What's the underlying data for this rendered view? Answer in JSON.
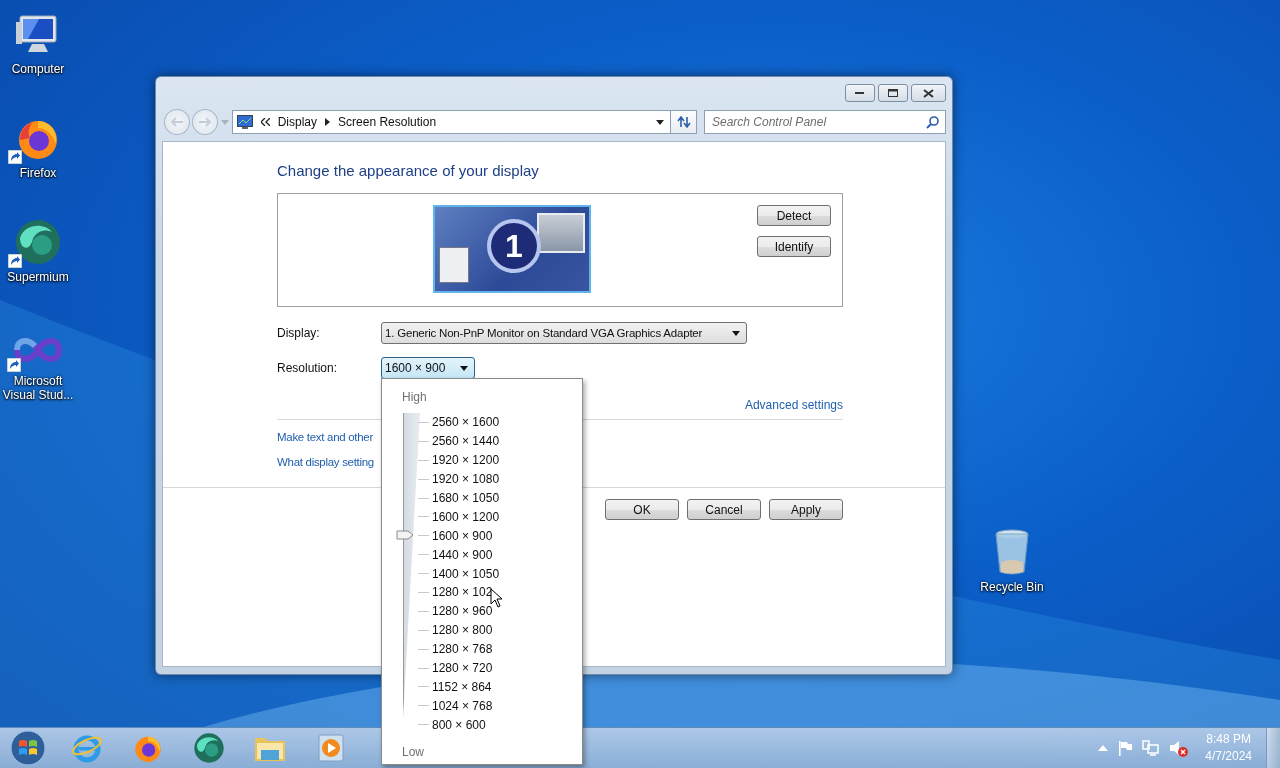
{
  "desktop_icons": [
    {
      "label": "Computer",
      "kind": "computer",
      "shortcut": false
    },
    {
      "label": "Firefox",
      "kind": "firefox",
      "shortcut": true
    },
    {
      "label": "Supermium",
      "kind": "supermium",
      "shortcut": true
    },
    {
      "label": "Microsoft Visual Stud...",
      "kind": "visualstudio",
      "shortcut": true
    },
    {
      "label": "Recycle Bin",
      "kind": "recyclebin",
      "shortcut": false
    }
  ],
  "window": {
    "breadcrumb": [
      "Display",
      "Screen Resolution"
    ],
    "search": {
      "placeholder": "Search Control Panel"
    },
    "heading": "Change the appearance of your display",
    "monitor_number": "1",
    "side_buttons": [
      "Detect",
      "Identify"
    ],
    "display": {
      "label": "Display:",
      "value": "1. Generic Non-PnP Monitor on Standard VGA Graphics Adapter"
    },
    "resolution": {
      "label": "Resolution:",
      "value": "1600 × 900",
      "expanded": true
    },
    "advanced_link": "Advanced settings",
    "links": [
      "Make text and other",
      "What display setting"
    ],
    "buttons": [
      "OK",
      "Cancel",
      "Apply"
    ]
  },
  "resolution_list": {
    "high_label": "High",
    "low_label": "Low",
    "items": [
      {
        "label": "2560 × 1600",
        "selected": false
      },
      {
        "label": "2560 × 1440",
        "selected": false
      },
      {
        "label": "1920 × 1200",
        "selected": false
      },
      {
        "label": "1920 × 1080",
        "selected": false
      },
      {
        "label": "1680 × 1050",
        "selected": false
      },
      {
        "label": "1600 × 1200",
        "selected": false
      },
      {
        "label": "1600 × 900",
        "selected": true
      },
      {
        "label": "1440 × 900",
        "selected": false
      },
      {
        "label": "1400 × 1050",
        "selected": false
      },
      {
        "label": "1280 × 102",
        "selected": false,
        "pointer": true
      },
      {
        "label": "1280 × 960",
        "selected": false
      },
      {
        "label": "1280 × 800",
        "selected": false
      },
      {
        "label": "1280 × 768",
        "selected": false
      },
      {
        "label": "1280 × 720",
        "selected": false
      },
      {
        "label": "1152 × 864",
        "selected": false
      },
      {
        "label": "1024 × 768",
        "selected": false
      },
      {
        "label": "800 × 600",
        "selected": false
      }
    ]
  },
  "taskbar": {
    "pinned": [
      {
        "kind": "ie"
      },
      {
        "kind": "firefox"
      },
      {
        "kind": "supermium"
      },
      {
        "kind": "explorer"
      },
      {
        "kind": "mediaplayer"
      }
    ],
    "clock": {
      "time": "8:48 PM",
      "date": "4/7/2024"
    },
    "tray": [
      {
        "kind": "arrow"
      },
      {
        "kind": "flag"
      },
      {
        "kind": "network"
      },
      {
        "kind": "volume-muted"
      }
    ]
  }
}
